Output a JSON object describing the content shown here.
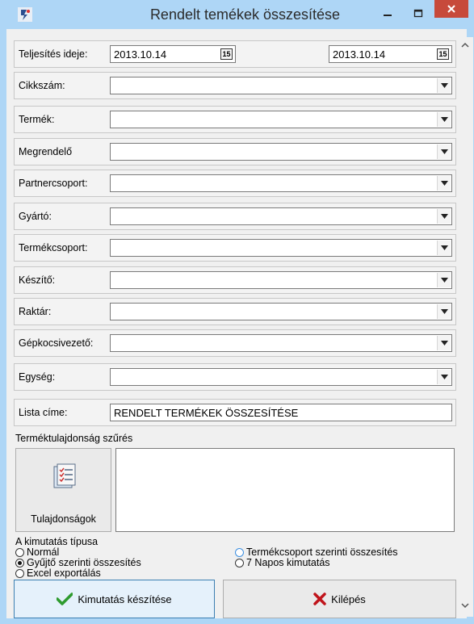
{
  "window": {
    "title": "Rendelt temékek összesítése",
    "minimize": "–",
    "maximize": "□",
    "close": "×"
  },
  "date_row": {
    "label": "Teljesítés ideje:",
    "from": "2013.10.14",
    "to": "2013.10.14",
    "calendar_glyph": "15"
  },
  "filters": [
    {
      "label": "Cikkszám:",
      "value": ""
    },
    {
      "label": "Termék:",
      "value": ""
    },
    {
      "label": "Megrendelő",
      "value": ""
    },
    {
      "label": "Partnercsoport:",
      "value": ""
    },
    {
      "label": "Gyártó:",
      "value": ""
    },
    {
      "label": "Termékcsoport:",
      "value": ""
    },
    {
      "label": "Készítő:",
      "value": ""
    },
    {
      "label": "Raktár:",
      "value": ""
    },
    {
      "label": "Gépkocsivezető:",
      "value": ""
    },
    {
      "label": "Egység:",
      "value": ""
    }
  ],
  "list_title": {
    "label": "Lista címe:",
    "value": "RENDELT TERMÉKEK ÖSSZESÍTÉSE"
  },
  "property_filter": {
    "group_label": "Terméktulajdonság szűrés",
    "button_label": "Tulajdonságok"
  },
  "report_type": {
    "group_label": "A kimutatás típusa",
    "options": [
      {
        "label": "Normál",
        "selected": false
      },
      {
        "label": "Gyűjtő szerinti összesítés",
        "selected": true
      },
      {
        "label": "Excel exportálás",
        "selected": false
      },
      {
        "label": "Termékcsoport szerinti összesítés",
        "selected": false
      },
      {
        "label": "7 Napos kimutatás",
        "selected": false
      }
    ]
  },
  "actions": {
    "create_label": "Kimutatás készítése",
    "exit_label": "Kilépés"
  },
  "colors": {
    "title_bar": "#aed6f6",
    "close_button": "#c74a3b",
    "check_icon": "#2e9b2e",
    "exit_icon": "#c0141b"
  }
}
